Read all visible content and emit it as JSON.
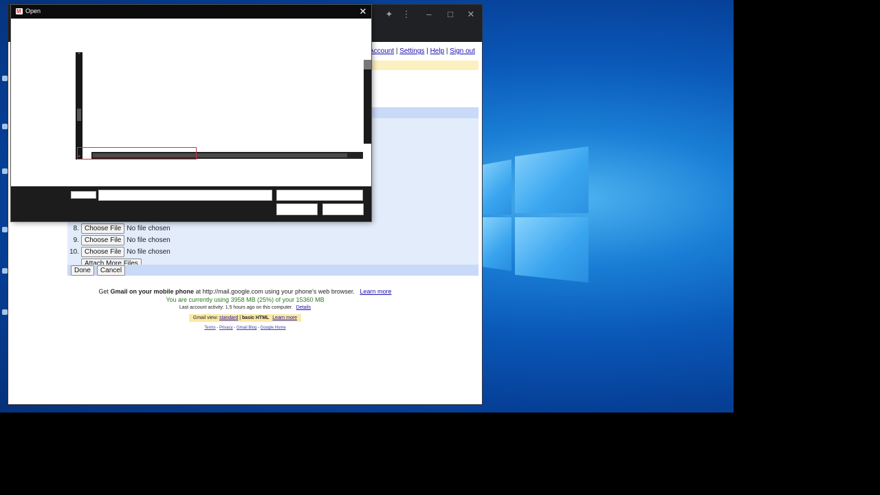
{
  "dialog": {
    "title": "Open"
  },
  "gmail": {
    "top_links": [
      "Google Account",
      "Settings",
      "Help",
      "Sign out"
    ],
    "top_links_visible_prefix": "ogle Account",
    "file_rows": [
      {
        "num": "8.",
        "button": "Choose File",
        "status": "No file chosen"
      },
      {
        "num": "9.",
        "button": "Choose File",
        "status": "No file chosen"
      },
      {
        "num": "10.",
        "button": "Choose File",
        "status": "No file chosen"
      }
    ],
    "attach_more": "Attach More Files",
    "done": "Done",
    "cancel": "Cancel",
    "footer": {
      "mobile_pre": "Get ",
      "mobile_bold": "Gmail on your mobile phone",
      "mobile_post": " at http://mail.google.com using your phone's web browser.",
      "mobile_link": "Learn more",
      "usage": "You are currently using 3958 MB (25%) of your 15360 MB",
      "activity": "Last account activity: 1.5 hours ago on this computer.",
      "details": "Details",
      "view_label": "Gmail view:",
      "view_standard": "standard",
      "view_sep": "|",
      "view_basic": "basic HTML",
      "view_learn": "Learn more",
      "terms": "Terms",
      "privacy": "Privacy",
      "blog": "Gmail Blog",
      "home": "Google Home",
      "sep": " - "
    }
  },
  "colors": {
    "dialog_title_bg": "#0c0c0c",
    "attach_panel_bg": "#e3ecfb",
    "usage_green": "#2b7a1f",
    "highlight_red": "#d4304a"
  }
}
